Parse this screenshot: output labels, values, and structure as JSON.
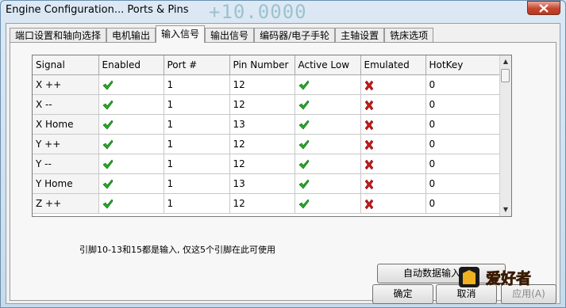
{
  "window": {
    "title": "Engine Configuration... Ports & Pins",
    "background_number": "+10.0000"
  },
  "tabs": [
    {
      "label": "端口设置和轴向选择",
      "active": false
    },
    {
      "label": "电机输出",
      "active": false
    },
    {
      "label": "输入信号",
      "active": true
    },
    {
      "label": "输出信号",
      "active": false
    },
    {
      "label": "编码器/电子手轮",
      "active": false
    },
    {
      "label": "主轴设置",
      "active": false
    },
    {
      "label": "铣床选项",
      "active": false
    }
  ],
  "table": {
    "headers": [
      "Signal",
      "Enabled",
      "Port #",
      "Pin Number",
      "Active Low",
      "Emulated",
      "HotKey"
    ],
    "rows": [
      {
        "signal": "X ++",
        "enabled": true,
        "port": "1",
        "pin": "12",
        "active_low": true,
        "emulated": false,
        "hotkey": "0"
      },
      {
        "signal": "X --",
        "enabled": true,
        "port": "1",
        "pin": "12",
        "active_low": true,
        "emulated": false,
        "hotkey": "0"
      },
      {
        "signal": "X Home",
        "enabled": true,
        "port": "1",
        "pin": "13",
        "active_low": true,
        "emulated": false,
        "hotkey": "0"
      },
      {
        "signal": "Y ++",
        "enabled": true,
        "port": "1",
        "pin": "12",
        "active_low": true,
        "emulated": false,
        "hotkey": "0"
      },
      {
        "signal": "Y --",
        "enabled": true,
        "port": "1",
        "pin": "12",
        "active_low": true,
        "emulated": false,
        "hotkey": "0"
      },
      {
        "signal": "Y Home",
        "enabled": true,
        "port": "1",
        "pin": "13",
        "active_low": true,
        "emulated": false,
        "hotkey": "0"
      },
      {
        "signal": "Z ++",
        "enabled": true,
        "port": "1",
        "pin": "12",
        "active_low": true,
        "emulated": false,
        "hotkey": "0"
      }
    ]
  },
  "note": "引脚10-13和15都是输入, 仅这5个引脚在此可使用",
  "buttons": {
    "auto_setup": "自动数据输入设置",
    "ok": "确定",
    "cancel": "取消",
    "apply": "应用(A)"
  },
  "watermark": {
    "text": "爱好者"
  },
  "colors": {
    "check": "#22b022",
    "cross": "#c81818",
    "close": "#c8452f"
  },
  "icons": {
    "enabled_true": "green-check-icon",
    "emulated_false": "red-x-icon"
  }
}
